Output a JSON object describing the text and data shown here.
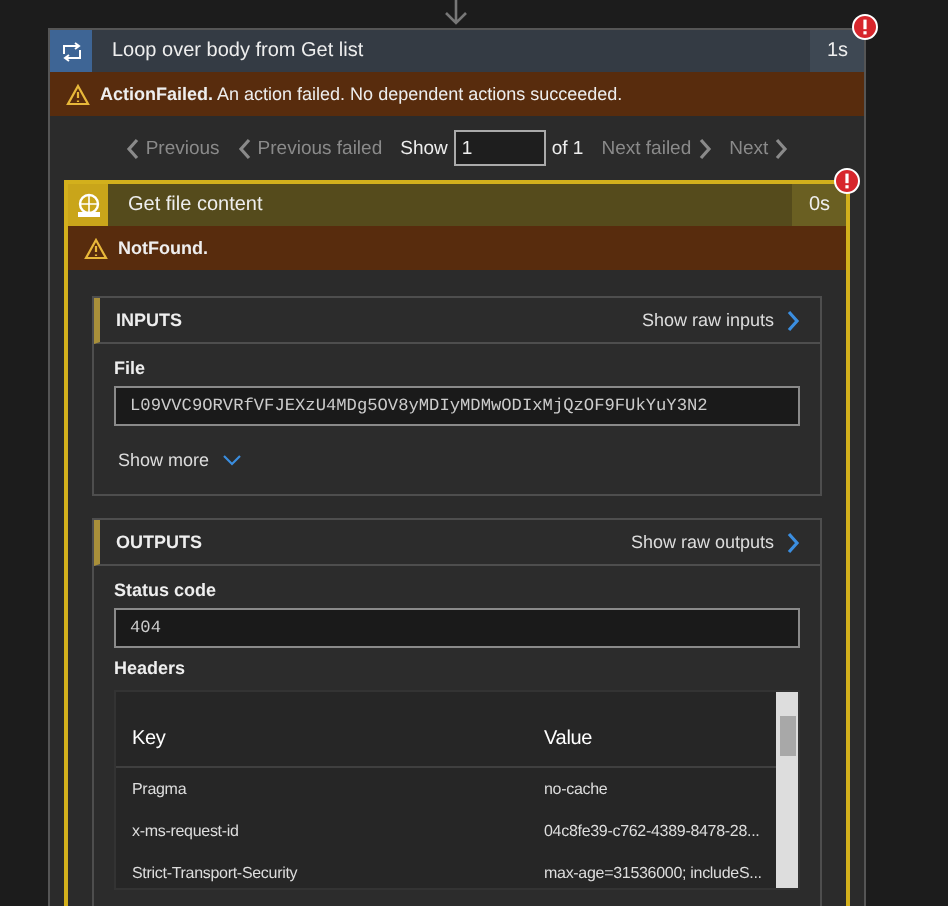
{
  "loop": {
    "title": "Loop over body from Get list",
    "duration": "1s",
    "error": true,
    "message": "**ActionFailed.** An action failed. No dependent actions succeeded."
  },
  "pager": {
    "back": [
      {
        "label": "Previous",
        "disabled": true
      },
      {
        "label": "Previous failed",
        "disabled": true
      }
    ],
    "show_label": "Show",
    "page": "1",
    "of": "of 1",
    "forward": [
      {
        "label": "Next failed",
        "disabled": true
      },
      {
        "label": "Next",
        "disabled": true
      }
    ]
  },
  "action": {
    "title": "Get file content",
    "duration": "0s",
    "error": true,
    "message": "NotFound.",
    "inputs": {
      "title": "INPUTS",
      "raw_link": "Show raw inputs",
      "fields": [
        {
          "label": "File",
          "value": "L09VVC9ORVRfVFJEXzU4MDg5OV8yMDIyMDMwODIxMjQzOF9FUkYuY3N2"
        }
      ],
      "show_more": "Show more"
    },
    "outputs": {
      "title": "OUTPUTS",
      "raw_link": "Show raw outputs",
      "fields": [
        {
          "label": "Status code",
          "value": "404"
        }
      ],
      "headers": {
        "label": "Headers",
        "columns": [
          "Key",
          "Value"
        ],
        "rows": [
          [
            "Pragma",
            "no-cache"
          ],
          [
            "x-ms-request-id",
            "04c8fe39-c762-4389-8478-28..."
          ],
          [
            "Strict-Transport-Security",
            "max-age=31536000; includeS..."
          ]
        ]
      }
    }
  }
}
